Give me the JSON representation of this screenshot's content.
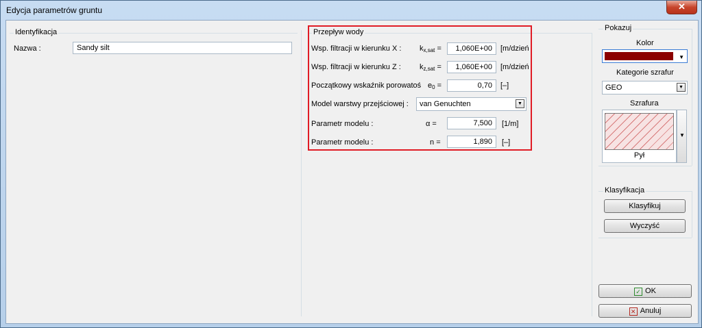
{
  "window": {
    "title": "Edycja parametrów gruntu",
    "close_glyph": "✕"
  },
  "identification": {
    "group_title": "Identyfikacja",
    "name_label": "Nazwa :",
    "name_value": "Sandy silt"
  },
  "water_flow": {
    "group_title": "Przepływ wody",
    "rows": [
      {
        "label": "Wsp. filtracji w kierunku X :",
        "symbol": "k",
        "subscript": "x,sat",
        "eq": "=",
        "value": "1,060E+00",
        "unit": "[m/dzień"
      },
      {
        "label": "Wsp. filtracji w kierunku Z :",
        "symbol": "k",
        "subscript": "z,sat",
        "eq": "=",
        "value": "1,060E+00",
        "unit": "[m/dzień"
      },
      {
        "label": "Początkowy wskaźnik porowatoś",
        "symbol": "e",
        "subscript": "0",
        "eq": "=",
        "value": "0,70",
        "unit": "[–]"
      }
    ],
    "model_label": "Model warstwy przejściowej :",
    "model_value": "van Genuchten",
    "params": [
      {
        "label": "Parametr modelu :",
        "symbol": "α",
        "eq": "=",
        "value": "7,500",
        "unit": "[1/m]"
      },
      {
        "label": "Parametr modelu :",
        "symbol": "n",
        "eq": "=",
        "value": "1,890",
        "unit": "[–]"
      }
    ]
  },
  "show": {
    "group_title": "Pokazuj",
    "color_label": "Kolor",
    "color_value": "#8b0000",
    "category_label": "Kategorie szrafur",
    "category_value": "GEO",
    "hatch_label": "Szrafura",
    "hatch_name": "Pył"
  },
  "classification": {
    "group_title": "Klasyfikacja",
    "classify_label": "Klasyfikuj",
    "clear_label": "Wyczyść"
  },
  "actions": {
    "ok_label": "OK",
    "cancel_label": "Anuluj"
  },
  "icons": {
    "dropdown": "chevron-down-icon",
    "ok": "checkmark-icon",
    "cancel": "x-icon"
  }
}
